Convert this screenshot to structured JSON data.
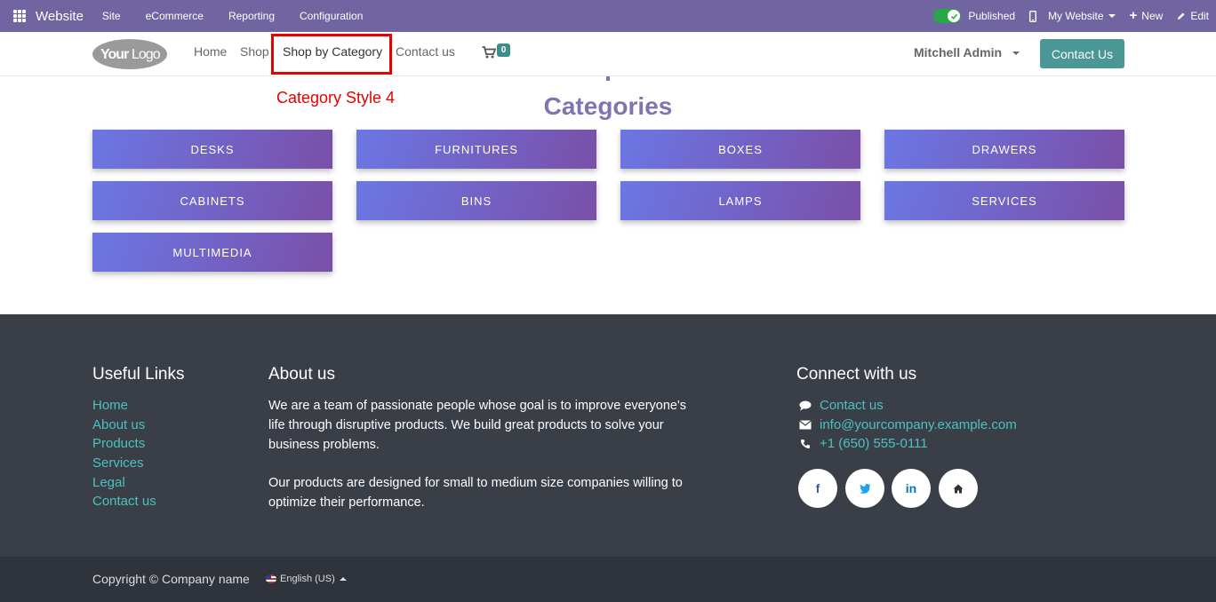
{
  "adminbar": {
    "brand": "Website",
    "menus": [
      "Site",
      "eCommerce",
      "Reporting",
      "Configuration"
    ],
    "published_label": "Published",
    "website_label": "My Website",
    "new_label": "New",
    "edit_label": "Edit"
  },
  "header": {
    "logo_text": "YourLogo",
    "nav": [
      "Home",
      "Shop",
      "Shop by Category",
      "Contact us"
    ],
    "cart_count": "0",
    "user": "Mitchell Admin",
    "cta": "Contact Us"
  },
  "annotation": "Category Style 4",
  "categories": {
    "title": "Categories",
    "items": [
      "DESKS",
      "FURNITURES",
      "BOXES",
      "DRAWERS",
      "CABINETS",
      "BINS",
      "LAMPS",
      "SERVICES",
      "MULTIMEDIA"
    ]
  },
  "footer": {
    "useful_links_title": "Useful Links",
    "links": [
      "Home",
      "About us",
      "Products",
      "Services",
      "Legal",
      "Contact us"
    ],
    "about_title": "About us",
    "about_p1": "We are a team of passionate people whose goal is to improve everyone's life through disruptive products. We build great products to solve your business problems.",
    "about_p2": "Our products are designed for small to medium size companies willing to optimize their performance.",
    "connect_title": "Connect with us",
    "contact_label": "Contact us",
    "email": "info@yourcompany.example.com",
    "phone": "+1 (650) 555-0111",
    "social": {
      "facebook": "f",
      "linkedin": "in"
    }
  },
  "bottom": {
    "copyright": "Copyright © Company name",
    "language": "English (US)"
  },
  "colors": {
    "admin_bar": "#7165a1",
    "accent": "#4a9795",
    "category_title": "#7d76b0",
    "gradient_start": "#6b77e4",
    "gradient_end": "#7a4fa8",
    "footer_bg": "#393e47",
    "link": "#4bc2c1",
    "annotation": "#e60000"
  }
}
